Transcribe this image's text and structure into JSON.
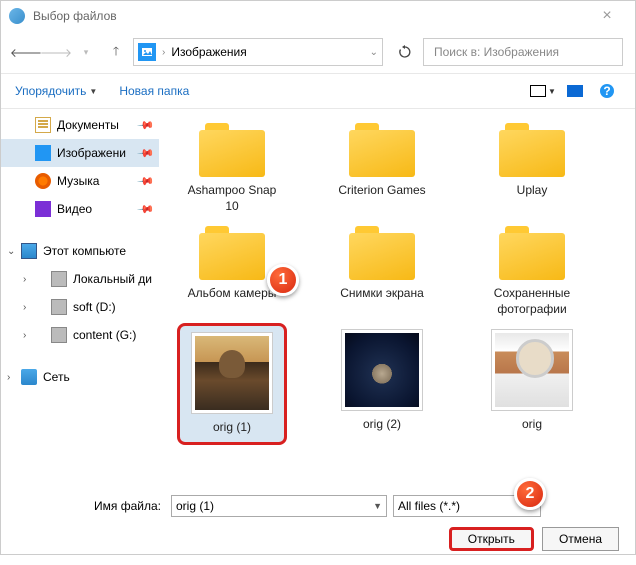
{
  "title": "Выбор файлов",
  "path": {
    "location": "Изображения"
  },
  "search": {
    "placeholder": "Поиск в: Изображения"
  },
  "toolbar": {
    "organize": "Упорядочить",
    "newfolder": "Новая папка"
  },
  "sidebar": {
    "docs": "Документы",
    "images": "Изображени",
    "music": "Музыка",
    "video": "Видео",
    "thispc": "Этот компьюте",
    "localdisk": "Локальный ди",
    "soft": "soft (D:)",
    "content": "content (G:)",
    "network": "Сеть"
  },
  "items": {
    "f1": "Ashampoo Snap 10",
    "f2": "Criterion Games",
    "f3": "Uplay",
    "f4": "Альбом камеры",
    "f5": "Снимки экрана",
    "f6": "Сохраненные фотографии",
    "i1": "orig (1)",
    "i2": "orig (2)",
    "i3": "orig"
  },
  "badges": {
    "one": "1",
    "two": "2"
  },
  "footer": {
    "fnlabel": "Имя файла:",
    "fnvalue": "orig (1)",
    "filter": "All files (*.*)",
    "open": "Открыть",
    "cancel": "Отмена"
  }
}
